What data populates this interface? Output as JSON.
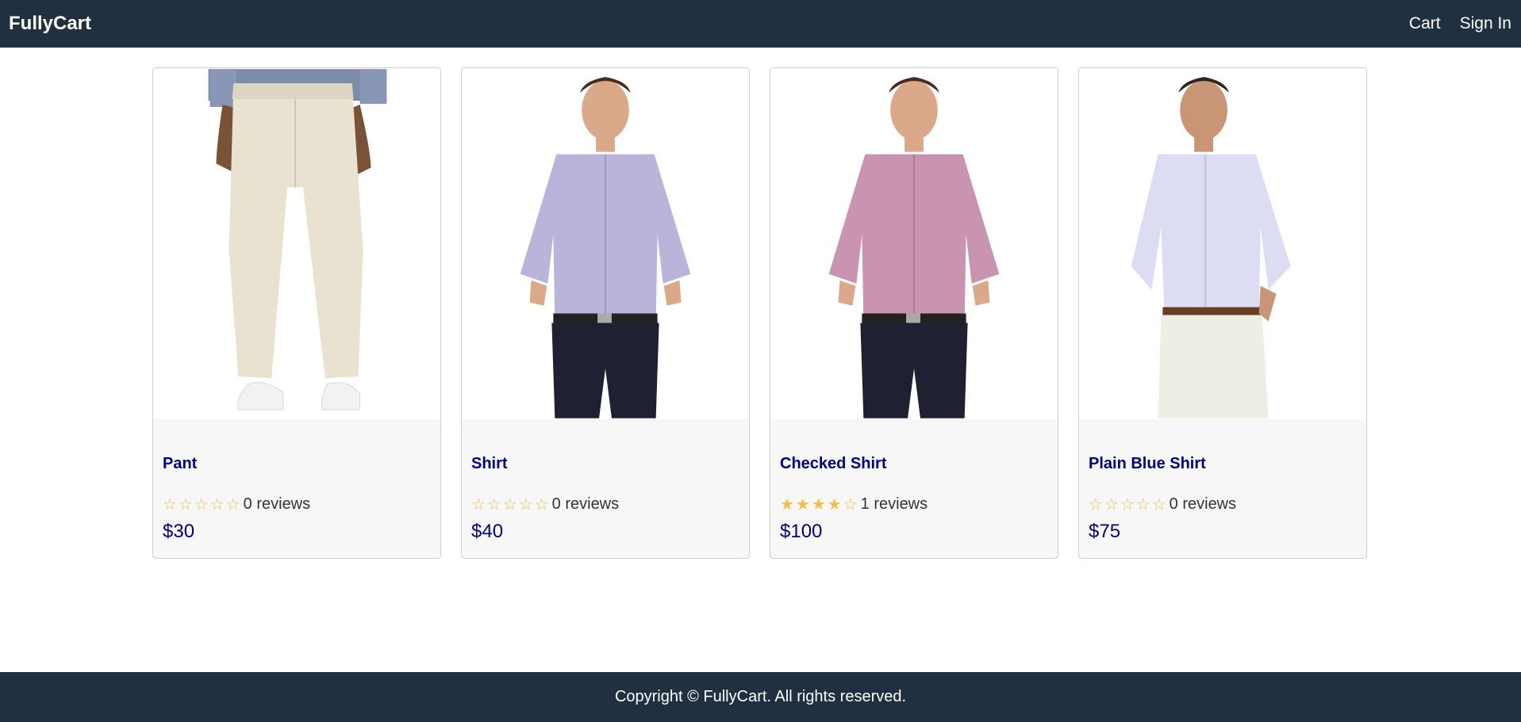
{
  "header": {
    "brand": "FullyCart",
    "links": {
      "cart": "Cart",
      "signin": "Sign In"
    }
  },
  "products": [
    {
      "name": "Pant",
      "rating_stars": "☆☆☆☆☆",
      "reviews": "0 reviews",
      "price": "$30",
      "image_icon": "khaki-pants-photo"
    },
    {
      "name": "Shirt",
      "rating_stars": "☆☆☆☆☆",
      "reviews": "0 reviews",
      "price": "$40",
      "image_icon": "lavender-shirt-photo"
    },
    {
      "name": "Checked Shirt",
      "rating_stars": "★★★★☆",
      "reviews": "1 reviews",
      "price": "$100",
      "image_icon": "pink-checked-shirt-photo"
    },
    {
      "name": "Plain Blue Shirt",
      "rating_stars": "☆☆☆☆☆",
      "reviews": "0 reviews",
      "price": "$75",
      "image_icon": "light-blue-shirt-photo"
    }
  ],
  "footer": {
    "text": "Copyright © FullyCart. All rights reserved."
  },
  "colors": {
    "nav_bg": "#203040",
    "title": "#000080",
    "star": "#f0c040",
    "card_bg": "#f7f7f7"
  }
}
